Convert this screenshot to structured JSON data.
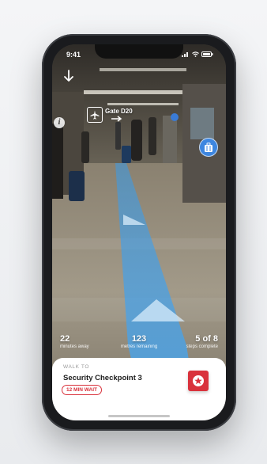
{
  "status_bar": {
    "time": "9:41"
  },
  "ar_labels": {
    "gate": "Gate D20"
  },
  "stats": [
    {
      "value": "22",
      "label": "minutes away"
    },
    {
      "value": "123",
      "label": "metres remaining"
    },
    {
      "value": "5 of 8",
      "label": "steps complete"
    }
  ],
  "destination_card": {
    "walk_to": "WALK TO",
    "name": "Security Checkpoint 3",
    "wait": "12 MIN WAIT"
  },
  "icons": {
    "down": "down-arrow-icon",
    "info": "info-icon",
    "gate": "airplane-icon",
    "luggage": "luggage-icon",
    "checkpoint": "security-star-icon"
  },
  "colors": {
    "path": "#3a9be8",
    "accent_red": "#d9323c",
    "luggage_blue": "#3d86e0"
  }
}
